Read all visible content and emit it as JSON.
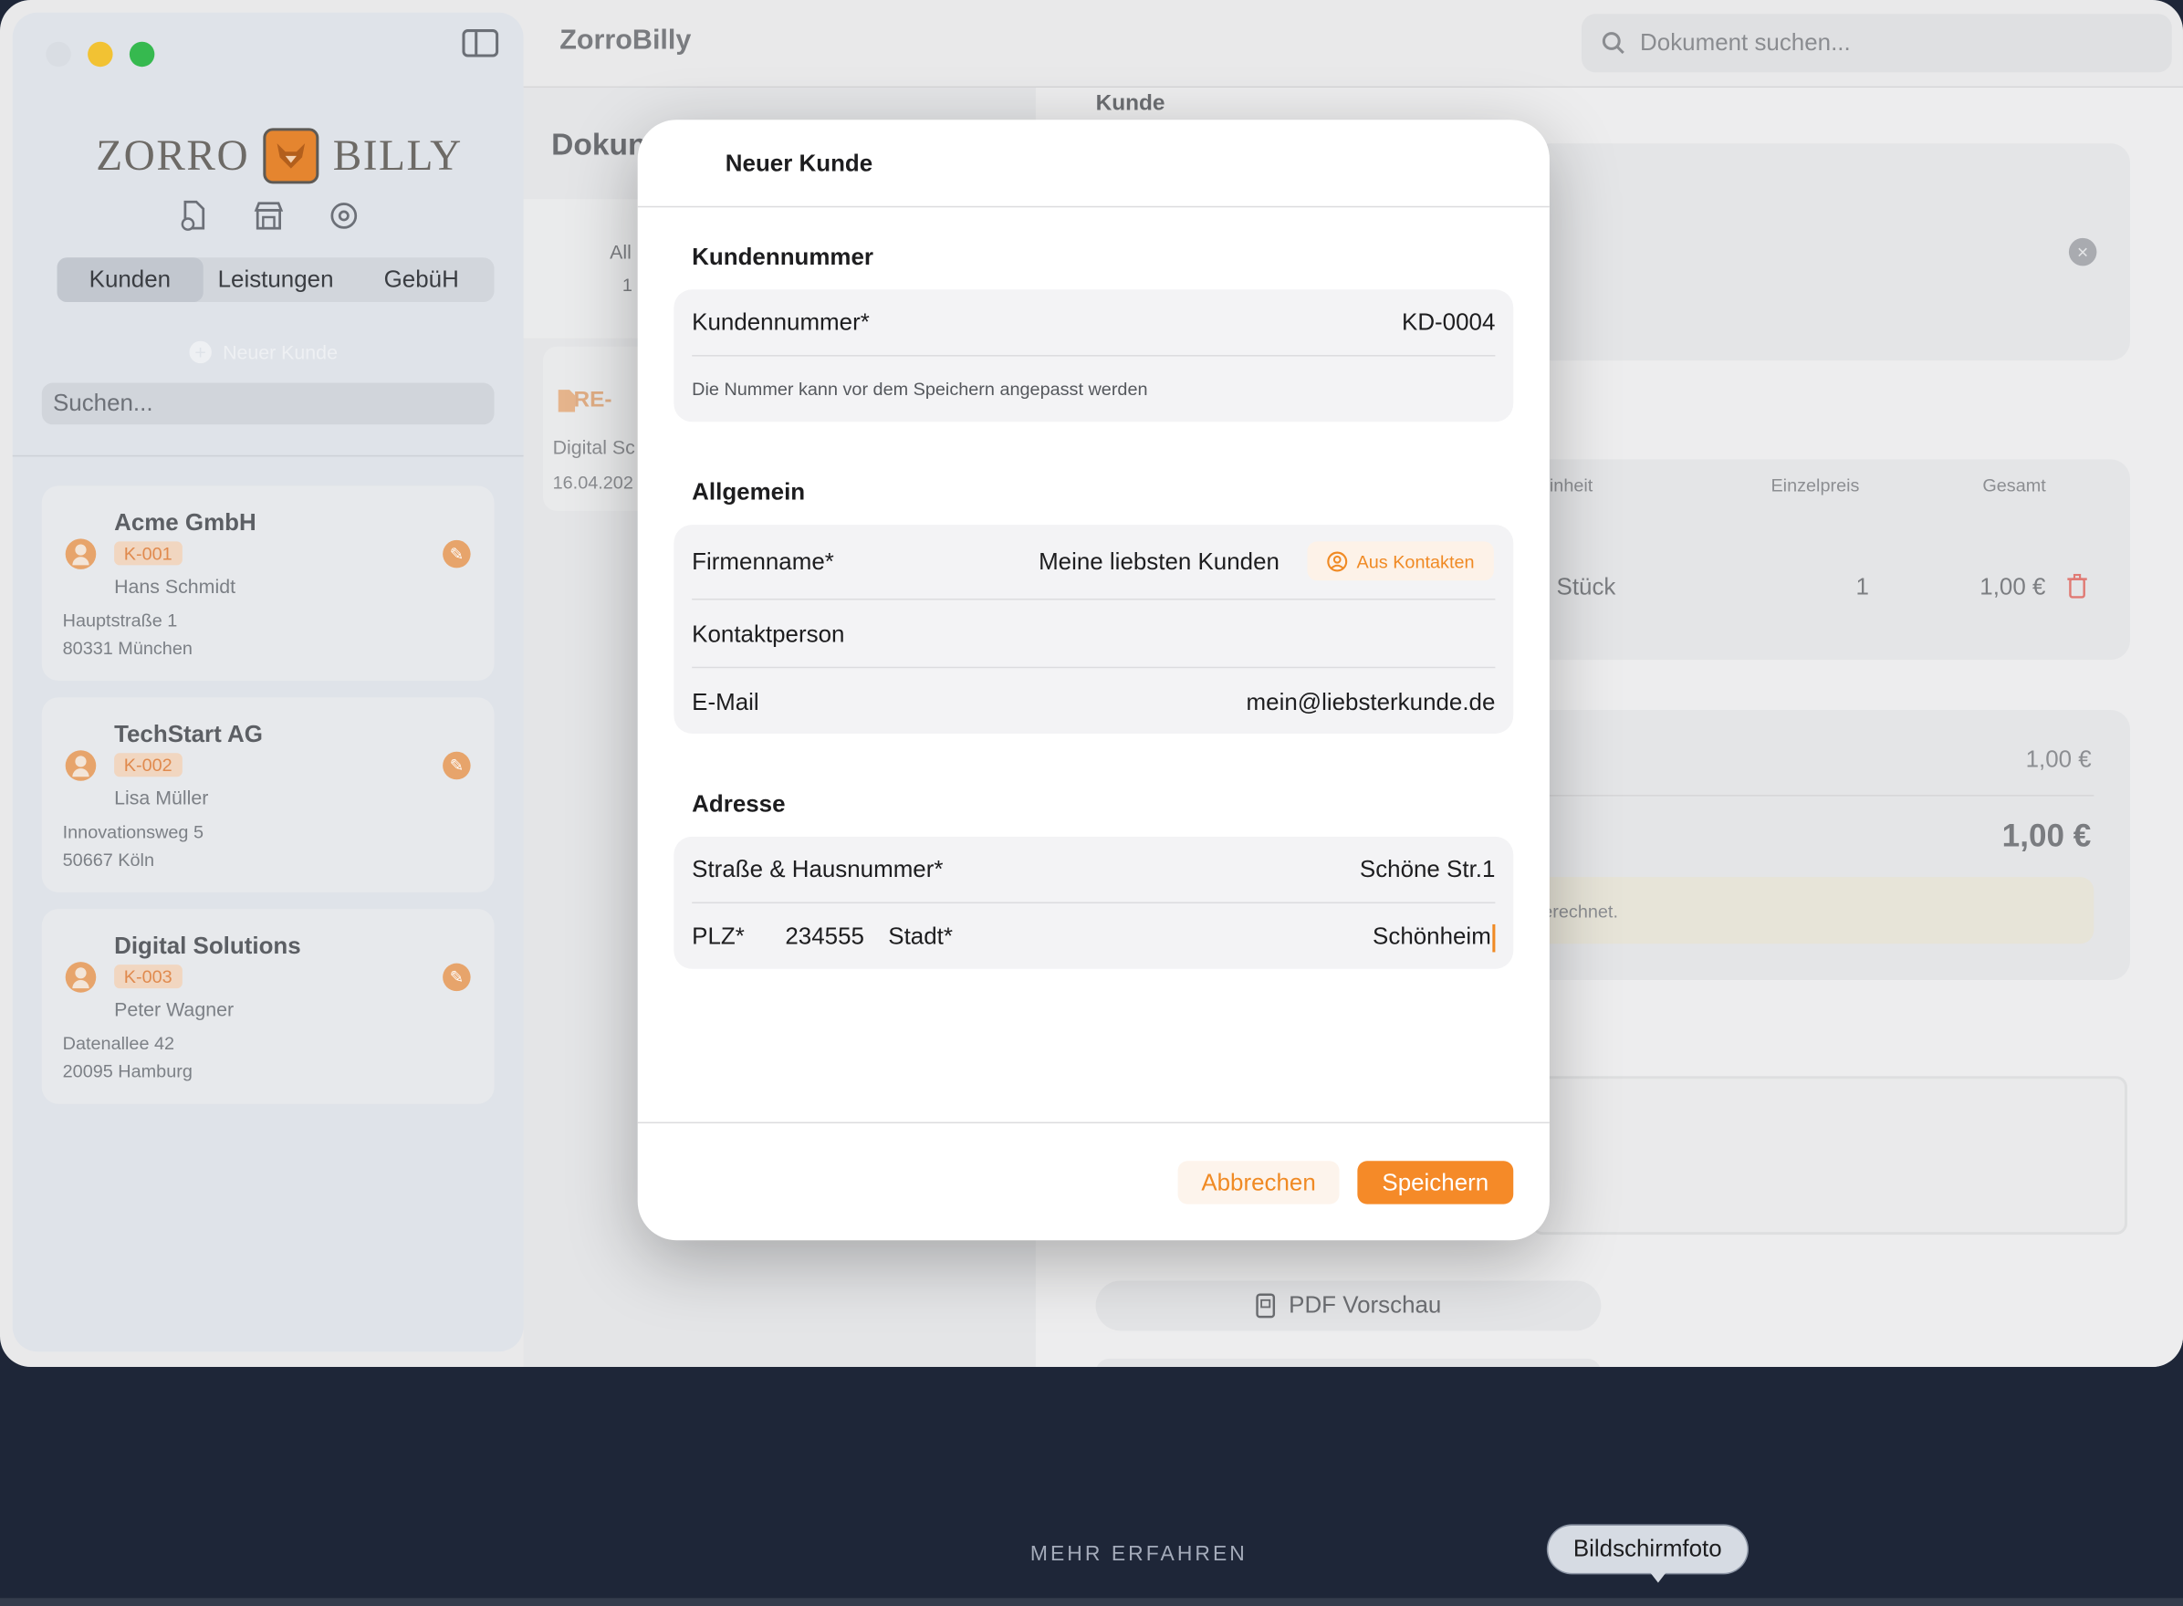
{
  "app": {
    "title": "ZorroBilly"
  },
  "search": {
    "placeholder": "Dokument suchen..."
  },
  "sidebar": {
    "logo_left": "ZORRO",
    "logo_right": "BILLY",
    "tabs": [
      "Kunden",
      "Leistungen",
      "GebüH"
    ],
    "new_customer": "Neuer Kunde",
    "search_placeholder": "Suchen...",
    "customers": [
      {
        "name": "Acme GmbH",
        "id": "K-001",
        "contact": "Hans Schmidt",
        "street": "Hauptstraße 1",
        "city": "80331 München"
      },
      {
        "name": "TechStart AG",
        "id": "K-002",
        "contact": "Lisa Müller",
        "street": "Innovationsweg 5",
        "city": "50667 Köln"
      },
      {
        "name": "Digital Solutions",
        "id": "K-003",
        "contact": "Peter Wagner",
        "street": "Datenallee 42",
        "city": "20095 Hamburg"
      }
    ]
  },
  "middle": {
    "header": "Dokun",
    "tab_text": "All",
    "tab_count": "1",
    "doc_title": "RE-",
    "doc_sub": "Digital Sc",
    "doc_date": "16.04.202"
  },
  "detail": {
    "kunde_label": "Kunde",
    "columns": {
      "einheit": "inheit",
      "einzelpreis": "Einzelpreis",
      "gesamt": "Gesamt"
    },
    "item": {
      "einheit": "Stück",
      "einzelpreis": "1",
      "gesamt": "1,00 €"
    },
    "subtotal": "1,00 €",
    "total": "1,00 €",
    "note": "erechnet.",
    "pdf_button": "PDF Vorschau"
  },
  "modal": {
    "title": "Neuer Kunde",
    "sections": {
      "number": "Kundennummer",
      "general": "Allgemein",
      "address": "Adresse"
    },
    "number_label": "Kundennummer*",
    "number_value": "KD-0004",
    "number_hint": "Die Nummer kann vor dem Speichern angepasst werden",
    "company_label": "Firmenname*",
    "company_value": "Meine liebsten Kunden",
    "contacts_button": "Aus Kontakten",
    "contact_label": "Kontaktperson",
    "email_label": "E-Mail",
    "email_value": "mein@liebsterkunde.de",
    "street_label": "Straße & Hausnummer*",
    "street_value": "Schöne Str.1",
    "zip_label": "PLZ*",
    "zip_value": "234555",
    "city_label": "Stadt*",
    "city_value": "Schönheim",
    "cancel": "Abbrechen",
    "save": "Speichern"
  },
  "bottom": {
    "more": "MEHR ERFAHREN",
    "screenshot_tooltip": "Bildschirmfoto"
  },
  "colors": {
    "accent": "#f58a28",
    "tag": "#e08a4e",
    "background": "#1e2638"
  }
}
